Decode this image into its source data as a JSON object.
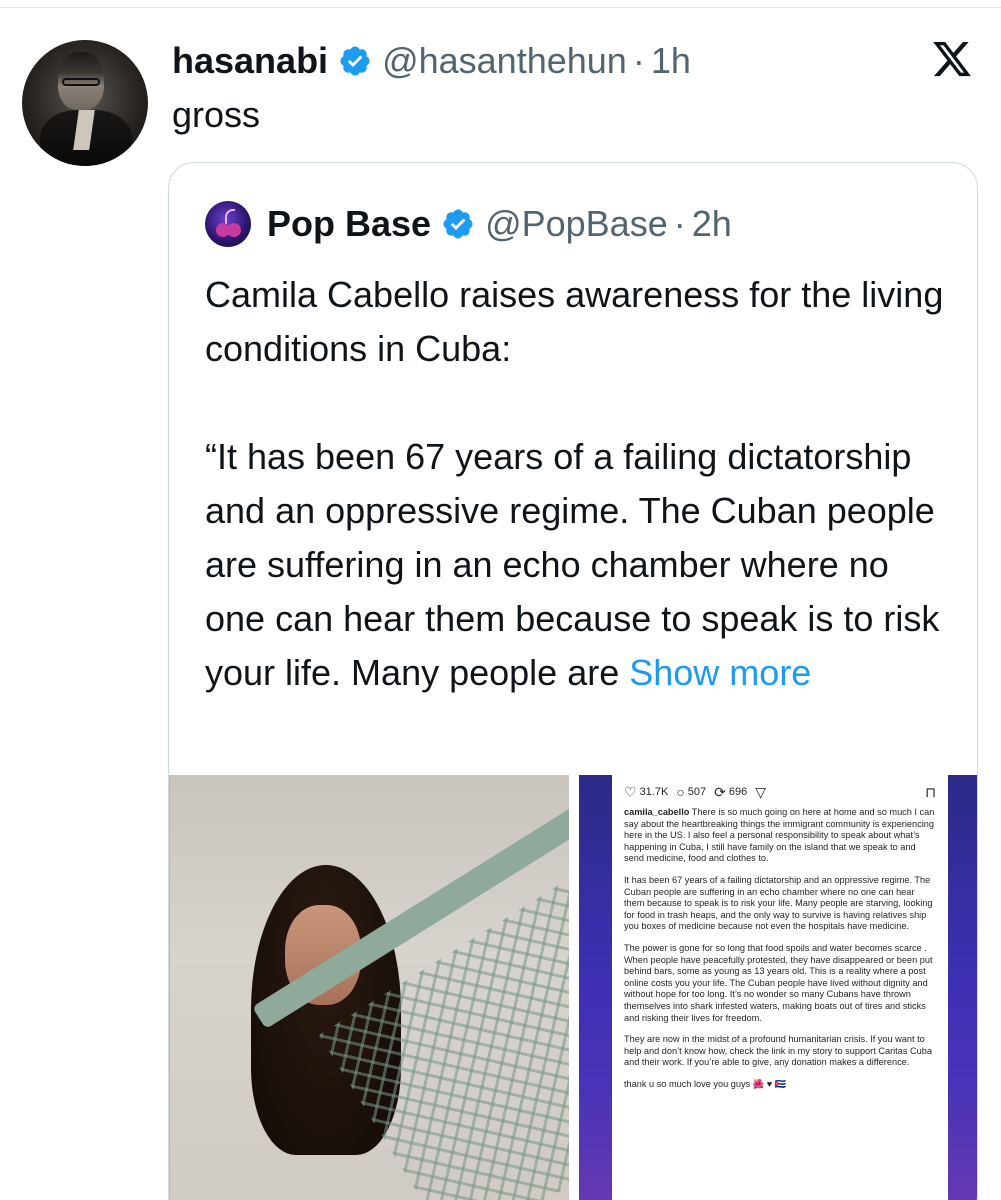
{
  "tweet": {
    "author_name": "hasanabi",
    "author_handle": "@hasanthehun",
    "separator": "·",
    "time": "1h",
    "text": "gross",
    "platform_icon": "x-logo-icon"
  },
  "quoted_tweet": {
    "author_name": "Pop Base",
    "author_handle": "@PopBase",
    "separator": "·",
    "time": "2h",
    "text_line1": "Camila Cabello raises awareness for the living conditions in Cuba:",
    "text_line2": "“It has been 67 years of a failing dictatorship and an oppressive regime. The Cuban people are suffering in an echo chamber where no one can hear them because to speak is to risk your life. Many people are",
    "show_more": "Show more"
  },
  "instagram_screenshot": {
    "likes": "31.7K",
    "comments": "507",
    "reposts": "696",
    "username": "camila_cabello",
    "caption_p1": "There is so much going on here at home and so much I can say about  the heartbreaking things the immigrant community is experiencing here in the US. I also feel a personal responsibility to speak about what’s happening in Cuba, I still  have family on the island that we speak to and send medicine, food and clothes to.",
    "caption_p2": "It has been 67 years of a failing dictatorship and an oppressive regime. The Cuban people are suffering in an echo chamber where no one can hear them because to speak is to risk your life. Many people are starving, looking for food in trash heaps, and the only way to survive is having relatives ship you boxes of medicine because not even the hospitals have medicine.",
    "caption_p3": "The power is gone for so long that food spoils and water becomes scarce . When people have peacefully protested, they have disappeared or been put behind bars, some as young as 13 years old. This is a reality where a post online costs you your life. The Cuban people have lived without dignity and without hope for too long. It’s no wonder so many Cubans have thrown themselves into shark infested waters, making boats out of tires and sticks and risking their lives for freedom.",
    "caption_p4": "They are now in the midst of a profound humanitarian crisis. If you want to help and don’t know how, check the link in my story to support Caritas Cuba and their work. If you’re able to give, any donation makes a difference.",
    "caption_p5": "thank u so much love you guys 🌺 ♥ 🇨🇺"
  },
  "colors": {
    "verified_blue": "#1d9bf0",
    "secondary_text": "#536471",
    "link": "#1d9bf0"
  }
}
